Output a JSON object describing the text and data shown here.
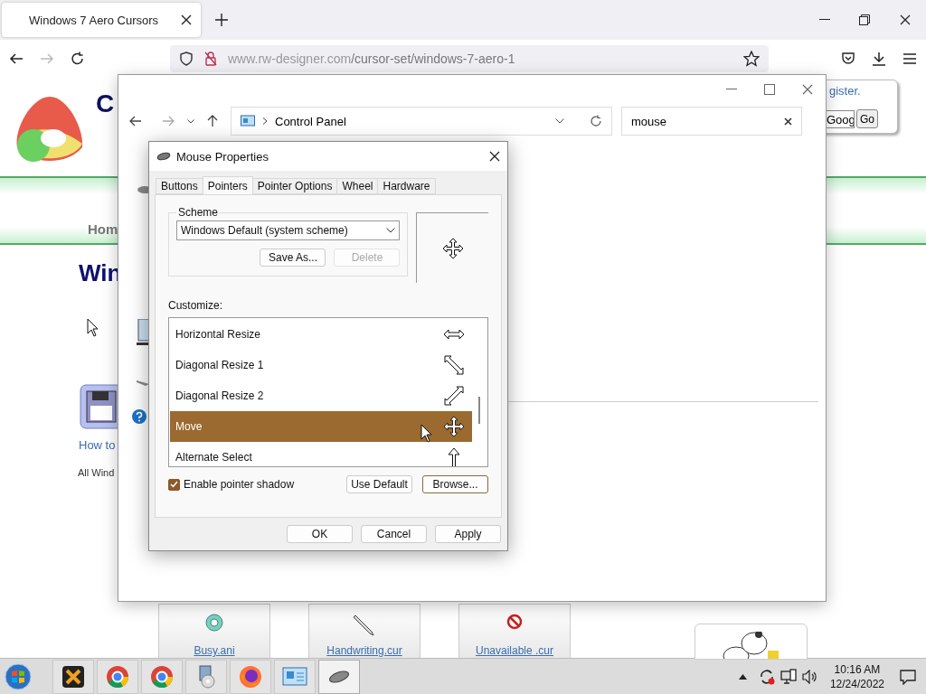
{
  "browser": {
    "tab_title": "Windows 7 Aero Cursors",
    "url_host": "www.rw-designer.com",
    "url_path": "/cursor-set/windows-7-aero-1"
  },
  "website": {
    "logo_letter": "C",
    "register_link": "gister.",
    "search_value": "Goog",
    "go_button": "Go",
    "nav_item": "Hom",
    "heading": "Win",
    "help_link": "How to",
    "body_text": "All Wind",
    "cursor_tiles": [
      {
        "label": "Busy.ani",
        "kind": "busy"
      },
      {
        "label": "Handwriting.cur",
        "kind": "pen"
      },
      {
        "label": "Unavailable .cur",
        "kind": "unavailable"
      }
    ]
  },
  "explorer": {
    "breadcrumb": "Control Panel",
    "search_value": "mouse"
  },
  "dialog": {
    "title": "Mouse Properties",
    "tabs": [
      {
        "label": "Buttons",
        "selected": false
      },
      {
        "label": "Pointers",
        "selected": true
      },
      {
        "label": "Pointer Options",
        "selected": false
      },
      {
        "label": "Wheel",
        "selected": false
      },
      {
        "label": "Hardware",
        "selected": false
      }
    ],
    "scheme_label": "Scheme",
    "scheme_value": "Windows Default (system scheme)",
    "save_as": "Save As...",
    "delete": {
      "label": "Delete",
      "disabled": true
    },
    "customize_label": "Customize:",
    "pointers": [
      {
        "name": "Horizontal Resize",
        "kind": "horizontal",
        "selected": false
      },
      {
        "name": "Diagonal Resize 1",
        "kind": "diagonal1",
        "selected": false
      },
      {
        "name": "Diagonal Resize 2",
        "kind": "diagonal2",
        "selected": false
      },
      {
        "name": "Move",
        "kind": "move",
        "selected": true
      },
      {
        "name": "Alternate Select",
        "kind": "alternate",
        "selected": false
      }
    ],
    "shadow": {
      "label": "Enable pointer shadow",
      "checked": true
    },
    "use_default": "Use Default",
    "browse": "Browse...",
    "buttons": [
      "OK",
      "Cancel",
      "Apply"
    ]
  },
  "taskbar": {
    "apps": [
      {
        "kind": "tool",
        "selected": false
      },
      {
        "kind": "chrome-cut",
        "selected": false
      },
      {
        "kind": "chrome",
        "selected": false
      },
      {
        "kind": "installer",
        "selected": false
      },
      {
        "kind": "firefox",
        "selected": false
      },
      {
        "kind": "control-panel",
        "selected": false
      },
      {
        "kind": "mouse",
        "selected": true
      }
    ],
    "time": "10:16 AM",
    "date": "12/24/2022"
  }
}
